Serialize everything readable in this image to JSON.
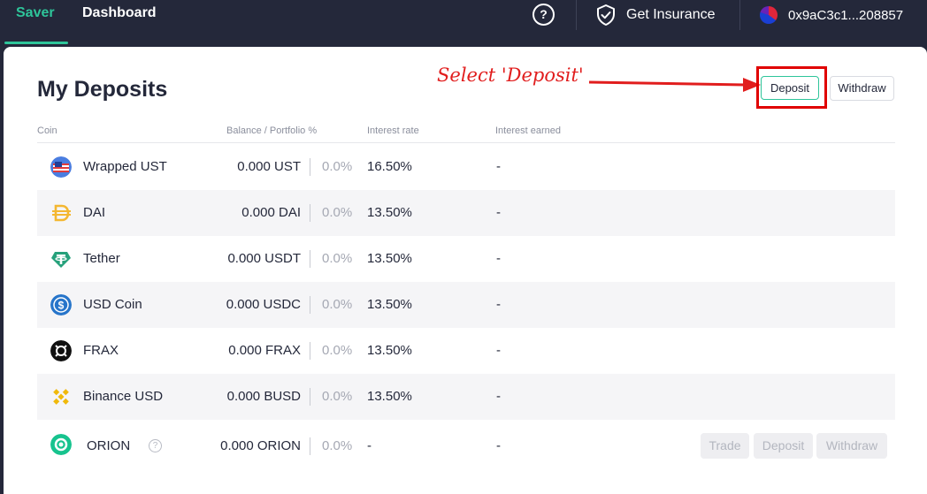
{
  "topbar": {
    "saver_tab": "Saver",
    "dashboard_tab": "Dashboard",
    "help_glyph": "?",
    "insurance_label": "Get Insurance",
    "wallet_address": "0x9aC3c1...208857"
  },
  "main": {
    "title": "My Deposits",
    "annotation": "Select 'Deposit'",
    "deposit_button": "Deposit",
    "withdraw_button": "Withdraw",
    "columns": {
      "coin": "Coin",
      "balance": "Balance / Portfolio %",
      "interest_rate": "Interest rate",
      "interest_earned": "Interest earned"
    },
    "rows": [
      {
        "name": "Wrapped UST",
        "balance": "0.000 UST",
        "pct": "0.0%",
        "rate": "16.50%",
        "earned": "-",
        "icon": "ust-icon"
      },
      {
        "name": "DAI",
        "balance": "0.000 DAI",
        "pct": "0.0%",
        "rate": "13.50%",
        "earned": "-",
        "icon": "dai-icon"
      },
      {
        "name": "Tether",
        "balance": "0.000 USDT",
        "pct": "0.0%",
        "rate": "13.50%",
        "earned": "-",
        "icon": "tether-icon"
      },
      {
        "name": "USD Coin",
        "balance": "0.000 USDC",
        "pct": "0.0%",
        "rate": "13.50%",
        "earned": "-",
        "icon": "usdc-icon"
      },
      {
        "name": "FRAX",
        "balance": "0.000 FRAX",
        "pct": "0.0%",
        "rate": "13.50%",
        "earned": "-",
        "icon": "frax-icon"
      },
      {
        "name": "Binance USD",
        "balance": "0.000 BUSD",
        "pct": "0.0%",
        "rate": "13.50%",
        "earned": "-",
        "icon": "busd-icon"
      },
      {
        "name": "ORION",
        "balance": "0.000 ORION",
        "pct": "0.0%",
        "rate": "-",
        "earned": "-",
        "icon": "orion-icon",
        "info_glyph": "?"
      }
    ],
    "orion_actions": {
      "trade": "Trade",
      "deposit": "Deposit",
      "withdraw": "Withdraw"
    }
  },
  "colors": {
    "brand_green": "#2ec59a",
    "topbar_bg": "#24283a",
    "annotation_red": "#e11d1d"
  }
}
